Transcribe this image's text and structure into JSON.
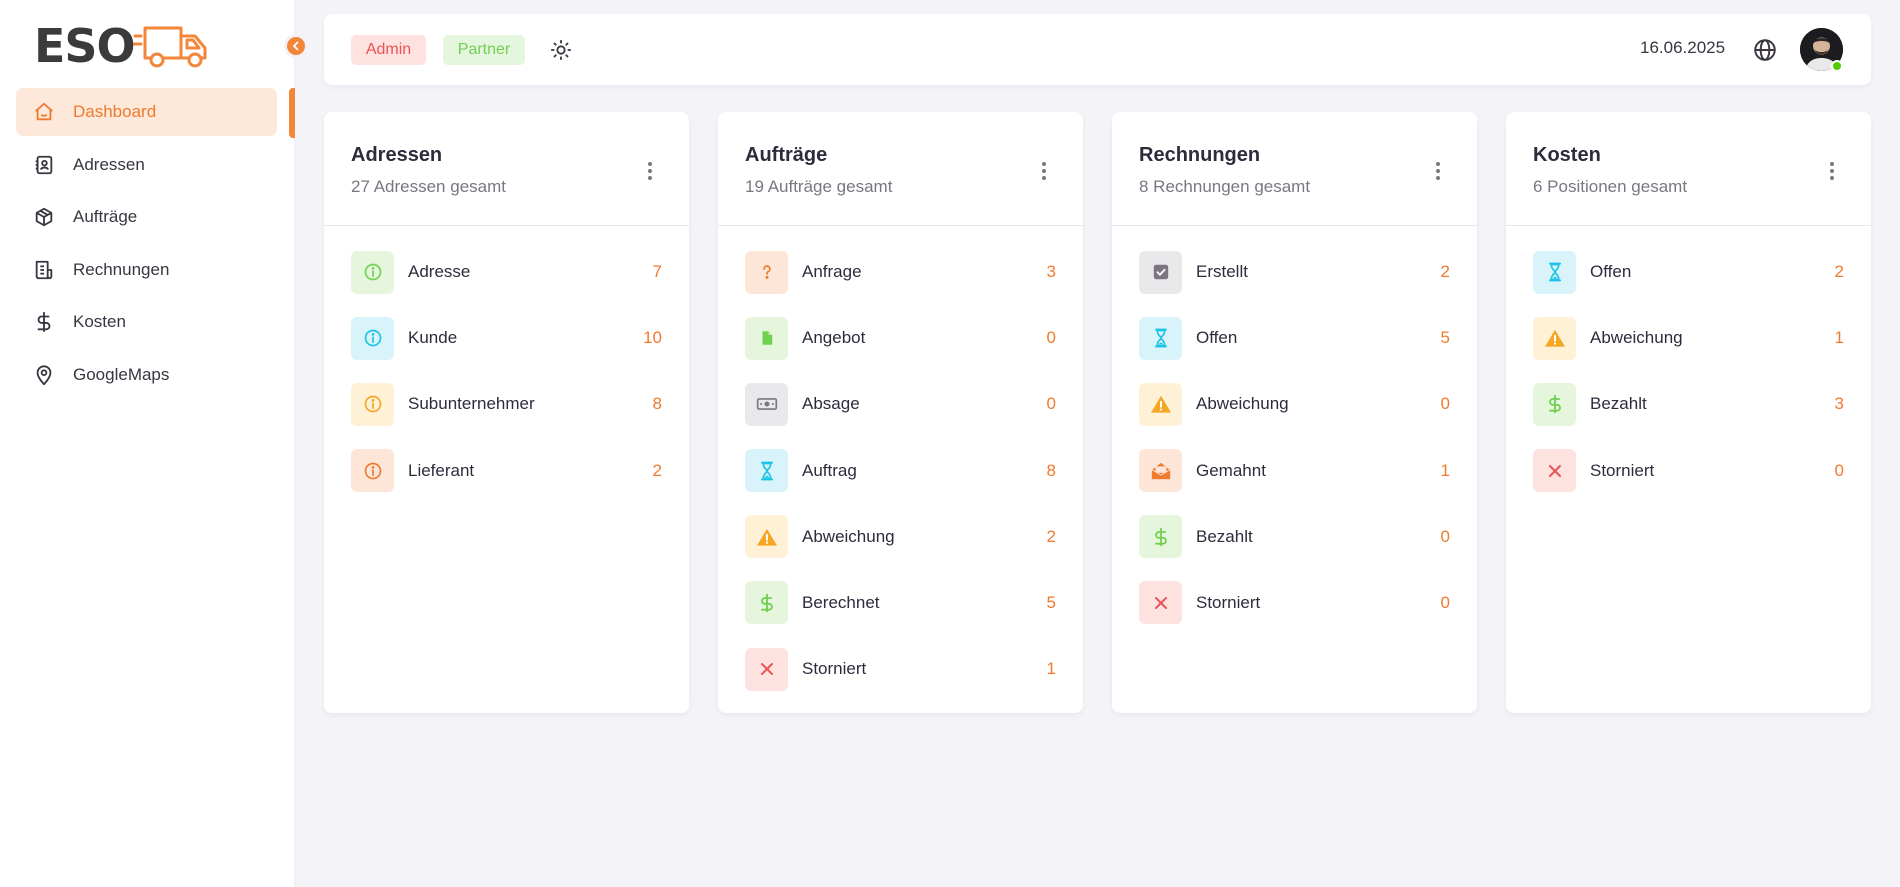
{
  "brand": {
    "logo_text": "ESO",
    "accent": "#f4863a"
  },
  "sidebar": {
    "items": [
      {
        "label": "Dashboard",
        "icon": "home-icon",
        "active": true
      },
      {
        "label": "Adressen",
        "icon": "address-book-icon"
      },
      {
        "label": "Aufträge",
        "icon": "package-icon"
      },
      {
        "label": "Rechnungen",
        "icon": "invoice-icon"
      },
      {
        "label": "Kosten",
        "icon": "dollar-icon"
      },
      {
        "label": "GoogleMaps",
        "icon": "map-pin-icon"
      }
    ]
  },
  "topbar": {
    "roles": [
      "Admin",
      "Partner"
    ],
    "date": "16.06.2025",
    "theme_icon": "sun-icon",
    "language_icon": "globe-icon",
    "avatar_status": "online"
  },
  "cards": [
    {
      "title": "Adressen",
      "subtitle": "27 Adressen gesamt",
      "rows": [
        {
          "label": "Adresse",
          "count": "7",
          "icon": "info-icon",
          "tone": "green"
        },
        {
          "label": "Kunde",
          "count": "10",
          "icon": "info-icon",
          "tone": "cyan"
        },
        {
          "label": "Subunternehmer",
          "count": "8",
          "icon": "info-icon",
          "tone": "yellow"
        },
        {
          "label": "Lieferant",
          "count": "2",
          "icon": "info-icon",
          "tone": "orange"
        }
      ]
    },
    {
      "title": "Aufträge",
      "subtitle": "19 Aufträge gesamt",
      "rows": [
        {
          "label": "Anfrage",
          "count": "3",
          "icon": "question-icon",
          "tone": "orange"
        },
        {
          "label": "Angebot",
          "count": "0",
          "icon": "file-icon",
          "tone": "green"
        },
        {
          "label": "Absage",
          "count": "0",
          "icon": "cash-icon",
          "tone": "gray"
        },
        {
          "label": "Auftrag",
          "count": "8",
          "icon": "hourglass-icon",
          "tone": "cyan"
        },
        {
          "label": "Abweichung",
          "count": "2",
          "icon": "warning-icon",
          "tone": "yellow"
        },
        {
          "label": "Berechnet",
          "count": "5",
          "icon": "dollar-icon",
          "tone": "green"
        },
        {
          "label": "Storniert",
          "count": "1",
          "icon": "close-icon",
          "tone": "red"
        }
      ]
    },
    {
      "title": "Rechnungen",
      "subtitle": "8 Rechnungen gesamt",
      "rows": [
        {
          "label": "Erstellt",
          "count": "2",
          "icon": "checkbox-icon",
          "tone": "gray"
        },
        {
          "label": "Offen",
          "count": "5",
          "icon": "hourglass-icon",
          "tone": "cyan"
        },
        {
          "label": "Abweichung",
          "count": "0",
          "icon": "warning-icon",
          "tone": "yellow"
        },
        {
          "label": "Gemahnt",
          "count": "1",
          "icon": "mail-open-icon",
          "tone": "orange"
        },
        {
          "label": "Bezahlt",
          "count": "0",
          "icon": "dollar-icon",
          "tone": "green"
        },
        {
          "label": "Storniert",
          "count": "0",
          "icon": "close-icon",
          "tone": "red"
        }
      ]
    },
    {
      "title": "Kosten",
      "subtitle": "6 Positionen gesamt",
      "rows": [
        {
          "label": "Offen",
          "count": "2",
          "icon": "hourglass-icon",
          "tone": "cyan"
        },
        {
          "label": "Abweichung",
          "count": "1",
          "icon": "warning-icon",
          "tone": "yellow"
        },
        {
          "label": "Bezahlt",
          "count": "3",
          "icon": "dollar-icon",
          "tone": "green"
        },
        {
          "label": "Storniert",
          "count": "0",
          "icon": "close-icon",
          "tone": "red"
        }
      ]
    }
  ]
}
